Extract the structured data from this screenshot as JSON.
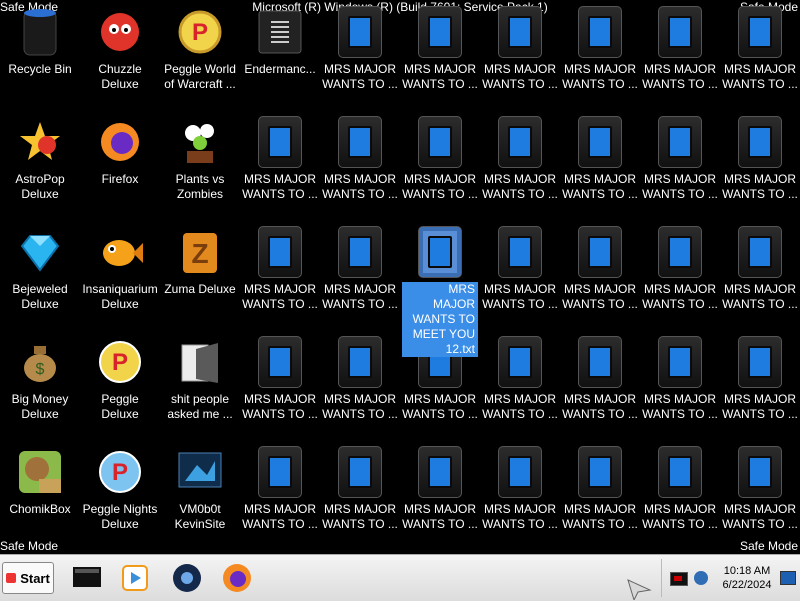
{
  "window_title": "Microsoft (R) Windows (R) (Build 7601: Service Pack 1)",
  "safe_mode_label": "Safe Mode",
  "desktop": {
    "columns": [
      [
        "Recycle Bin",
        "AstroPop Deluxe",
        "Bejeweled Deluxe",
        "Big Money Deluxe",
        "ChomikBox"
      ],
      [
        "Chuzzle Deluxe",
        "Firefox",
        "Insaniquarium Deluxe",
        "Peggle Deluxe",
        "Peggle Nights Deluxe"
      ],
      [
        "Peggle World of Warcraft ...",
        "Plants vs Zombies",
        "Zuma Deluxe",
        "shit people asked me ...",
        "VM0b0t KevinSite"
      ],
      [
        "Endermanc...",
        "MRS MAJOR WANTS TO ...",
        "MRS MAJOR WANTS TO ...",
        "MRS MAJOR WANTS TO ...",
        "MRS MAJOR WANTS TO ..."
      ],
      [
        "MRS MAJOR WANTS TO ...",
        "MRS MAJOR WANTS TO ...",
        "MRS MAJOR WANTS TO ...",
        "MRS MAJOR WANTS TO ...",
        "MRS MAJOR WANTS TO ..."
      ],
      [
        "MRS MAJOR WANTS TO ...",
        "MRS MAJOR WANTS TO ...",
        "MRS MAJOR WANTS TO MEET YOU 12.txt",
        "MRS MAJOR WANTS TO ...",
        "MRS MAJOR WANTS TO ..."
      ],
      [
        "MRS MAJOR WANTS TO ...",
        "MRS MAJOR WANTS TO ...",
        "MRS MAJOR WANTS TO ...",
        "MRS MAJOR WANTS TO ...",
        "MRS MAJOR WANTS TO ..."
      ],
      [
        "MRS MAJOR WANTS TO ...",
        "MRS MAJOR WANTS TO ...",
        "MRS MAJOR WANTS TO ...",
        "MRS MAJOR WANTS TO ...",
        "MRS MAJOR WANTS TO ..."
      ],
      [
        "MRS MAJOR WANTS TO ...",
        "MRS MAJOR WANTS TO ...",
        "MRS MAJOR WANTS TO ...",
        "MRS MAJOR WANTS TO ...",
        "MRS MAJOR WANTS TO ..."
      ],
      [
        "MRS MAJOR WANTS TO ...",
        "MRS MAJOR WANTS TO ...",
        "MRS MAJOR WANTS TO ...",
        "MRS MAJOR WANTS TO ...",
        "MRS MAJOR WANTS TO ..."
      ]
    ],
    "icons": [
      [
        "recycle-bin-icon",
        "astropop-icon",
        "bejeweled-icon",
        "big-money-icon",
        "chomikbox-icon"
      ],
      [
        "chuzzle-icon",
        "firefox-icon",
        "insaniquarium-icon",
        "peggle-icon",
        "peggle-nights-icon"
      ],
      [
        "peggle-wow-icon",
        "plants-vs-zombies-icon",
        "zuma-icon",
        "folder-icon",
        "vm-shortcut-icon"
      ],
      [
        "text-document-icon",
        "txt-file-icon",
        "txt-file-icon",
        "txt-file-icon",
        "txt-file-icon"
      ]
    ],
    "selected_label": "MRS MAJOR WANTS TO MEET YOU 12.txt"
  },
  "taskbar": {
    "start_label": "Start",
    "apps": [
      "window-icon",
      "media-player-icon",
      "globe-icon",
      "firefox-icon"
    ],
    "tray_icons": [
      "action-center-icon",
      "network-icon"
    ],
    "clock_time": "10:18 AM",
    "clock_date": "6/22/2024"
  },
  "colors": {
    "background": "#000000",
    "selection": "#3b8ee8",
    "txt_icon_screen": "#1e7be0"
  }
}
